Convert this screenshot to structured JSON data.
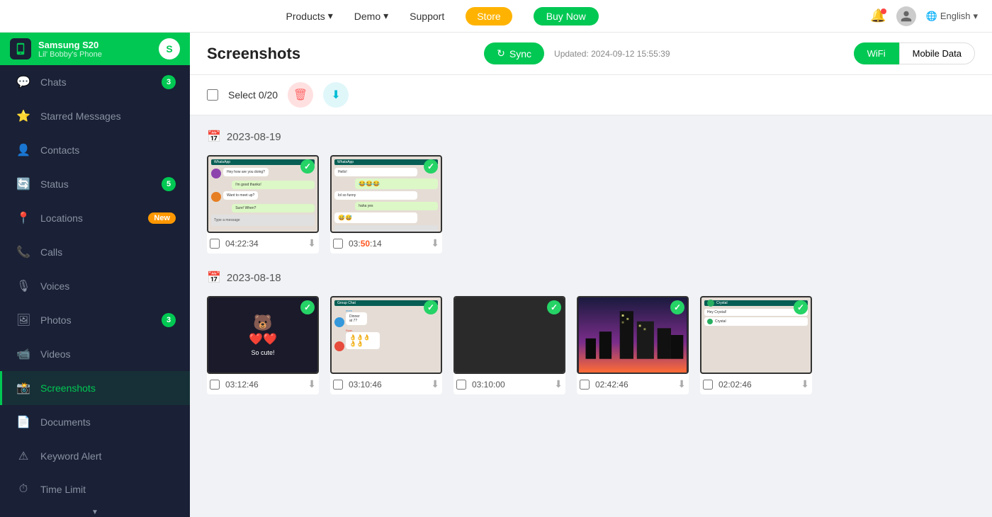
{
  "topnav": {
    "products_label": "Products",
    "demo_label": "Demo",
    "support_label": "Support",
    "store_label": "Store",
    "buynow_label": "Buy Now",
    "lang_label": "English"
  },
  "device": {
    "name": "Samsung S20",
    "sub": "Lil' Bobby's Phone",
    "initials": "S"
  },
  "sidebar": {
    "items": [
      {
        "id": "chats",
        "label": "Chats",
        "badge": "3",
        "badge_type": "number"
      },
      {
        "id": "starred",
        "label": "Starred Messages",
        "badge": "",
        "badge_type": "none"
      },
      {
        "id": "contacts",
        "label": "Contacts",
        "badge": "",
        "badge_type": "none"
      },
      {
        "id": "status",
        "label": "Status",
        "badge": "5",
        "badge_type": "number"
      },
      {
        "id": "locations",
        "label": "Locations",
        "badge": "New",
        "badge_type": "new"
      },
      {
        "id": "calls",
        "label": "Calls",
        "badge": "",
        "badge_type": "none"
      },
      {
        "id": "voices",
        "label": "Voices",
        "badge": "",
        "badge_type": "none"
      },
      {
        "id": "photos",
        "label": "Photos",
        "badge": "3",
        "badge_type": "number"
      },
      {
        "id": "videos",
        "label": "Videos",
        "badge": "",
        "badge_type": "none"
      },
      {
        "id": "screenshots",
        "label": "Screenshots",
        "badge": "",
        "badge_type": "none",
        "active": true
      },
      {
        "id": "documents",
        "label": "Documents",
        "badge": "",
        "badge_type": "none"
      },
      {
        "id": "keyword-alert",
        "label": "Keyword Alert",
        "badge": "",
        "badge_type": "none"
      },
      {
        "id": "time-limit",
        "label": "Time Limit",
        "badge": "",
        "badge_type": "none"
      }
    ]
  },
  "content": {
    "title": "Screenshots",
    "sync_label": "Sync",
    "update_time": "Updated: 2024-09-12 15:55:39",
    "wifi_label": "WiFi",
    "mobile_data_label": "Mobile Data",
    "select_label": "Select",
    "select_count": "0/20",
    "dates": [
      {
        "date": "2023-08-19",
        "screenshots": [
          {
            "time": "04:22:34",
            "highlight": "",
            "type": "chat1"
          },
          {
            "time": "03:50:14",
            "highlight": "50",
            "type": "chat2"
          }
        ]
      },
      {
        "date": "2023-08-18",
        "screenshots": [
          {
            "time": "03:12:46",
            "highlight": "",
            "type": "emoji"
          },
          {
            "time": "03:10:46",
            "highlight": "",
            "type": "chat3"
          },
          {
            "time": "03:10:00",
            "highlight": "",
            "type": "blank"
          },
          {
            "time": "02:42:46",
            "highlight": "",
            "type": "city"
          },
          {
            "time": "02:02:46",
            "highlight": "",
            "type": "chat4"
          }
        ]
      }
    ]
  }
}
